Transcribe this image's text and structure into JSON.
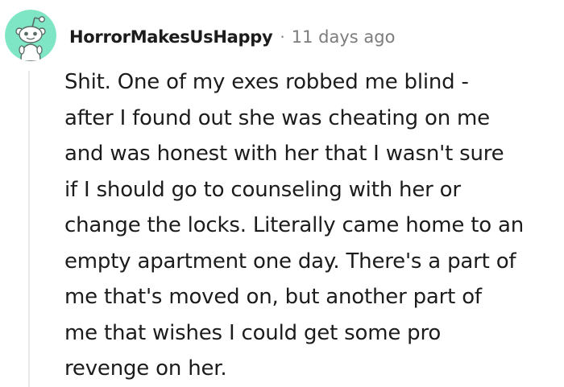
{
  "comment": {
    "username": "HorrorMakesUsHappy",
    "separator": "·",
    "timestamp": "11 days ago",
    "avatar_icon": "reddit-snoo-avatar-icon",
    "colors": {
      "avatar_background": "#7ee6c4",
      "username": "#1c1c1c",
      "timestamp": "#7c7c7c",
      "body_text": "#1c1c1c",
      "thread_line": "#e8eaec"
    },
    "body_lines": [
      "Shit. One of my exes robbed me blind -",
      "after I found out she was cheating on me",
      "and was honest with her that I wasn't sure",
      "if I should go to counseling with her or",
      "change the locks. Literally came home to an",
      "empty apartment one day. There's a part of",
      "me that's moved on, but another part of",
      "me that wishes I could get some pro",
      "revenge on her."
    ]
  }
}
